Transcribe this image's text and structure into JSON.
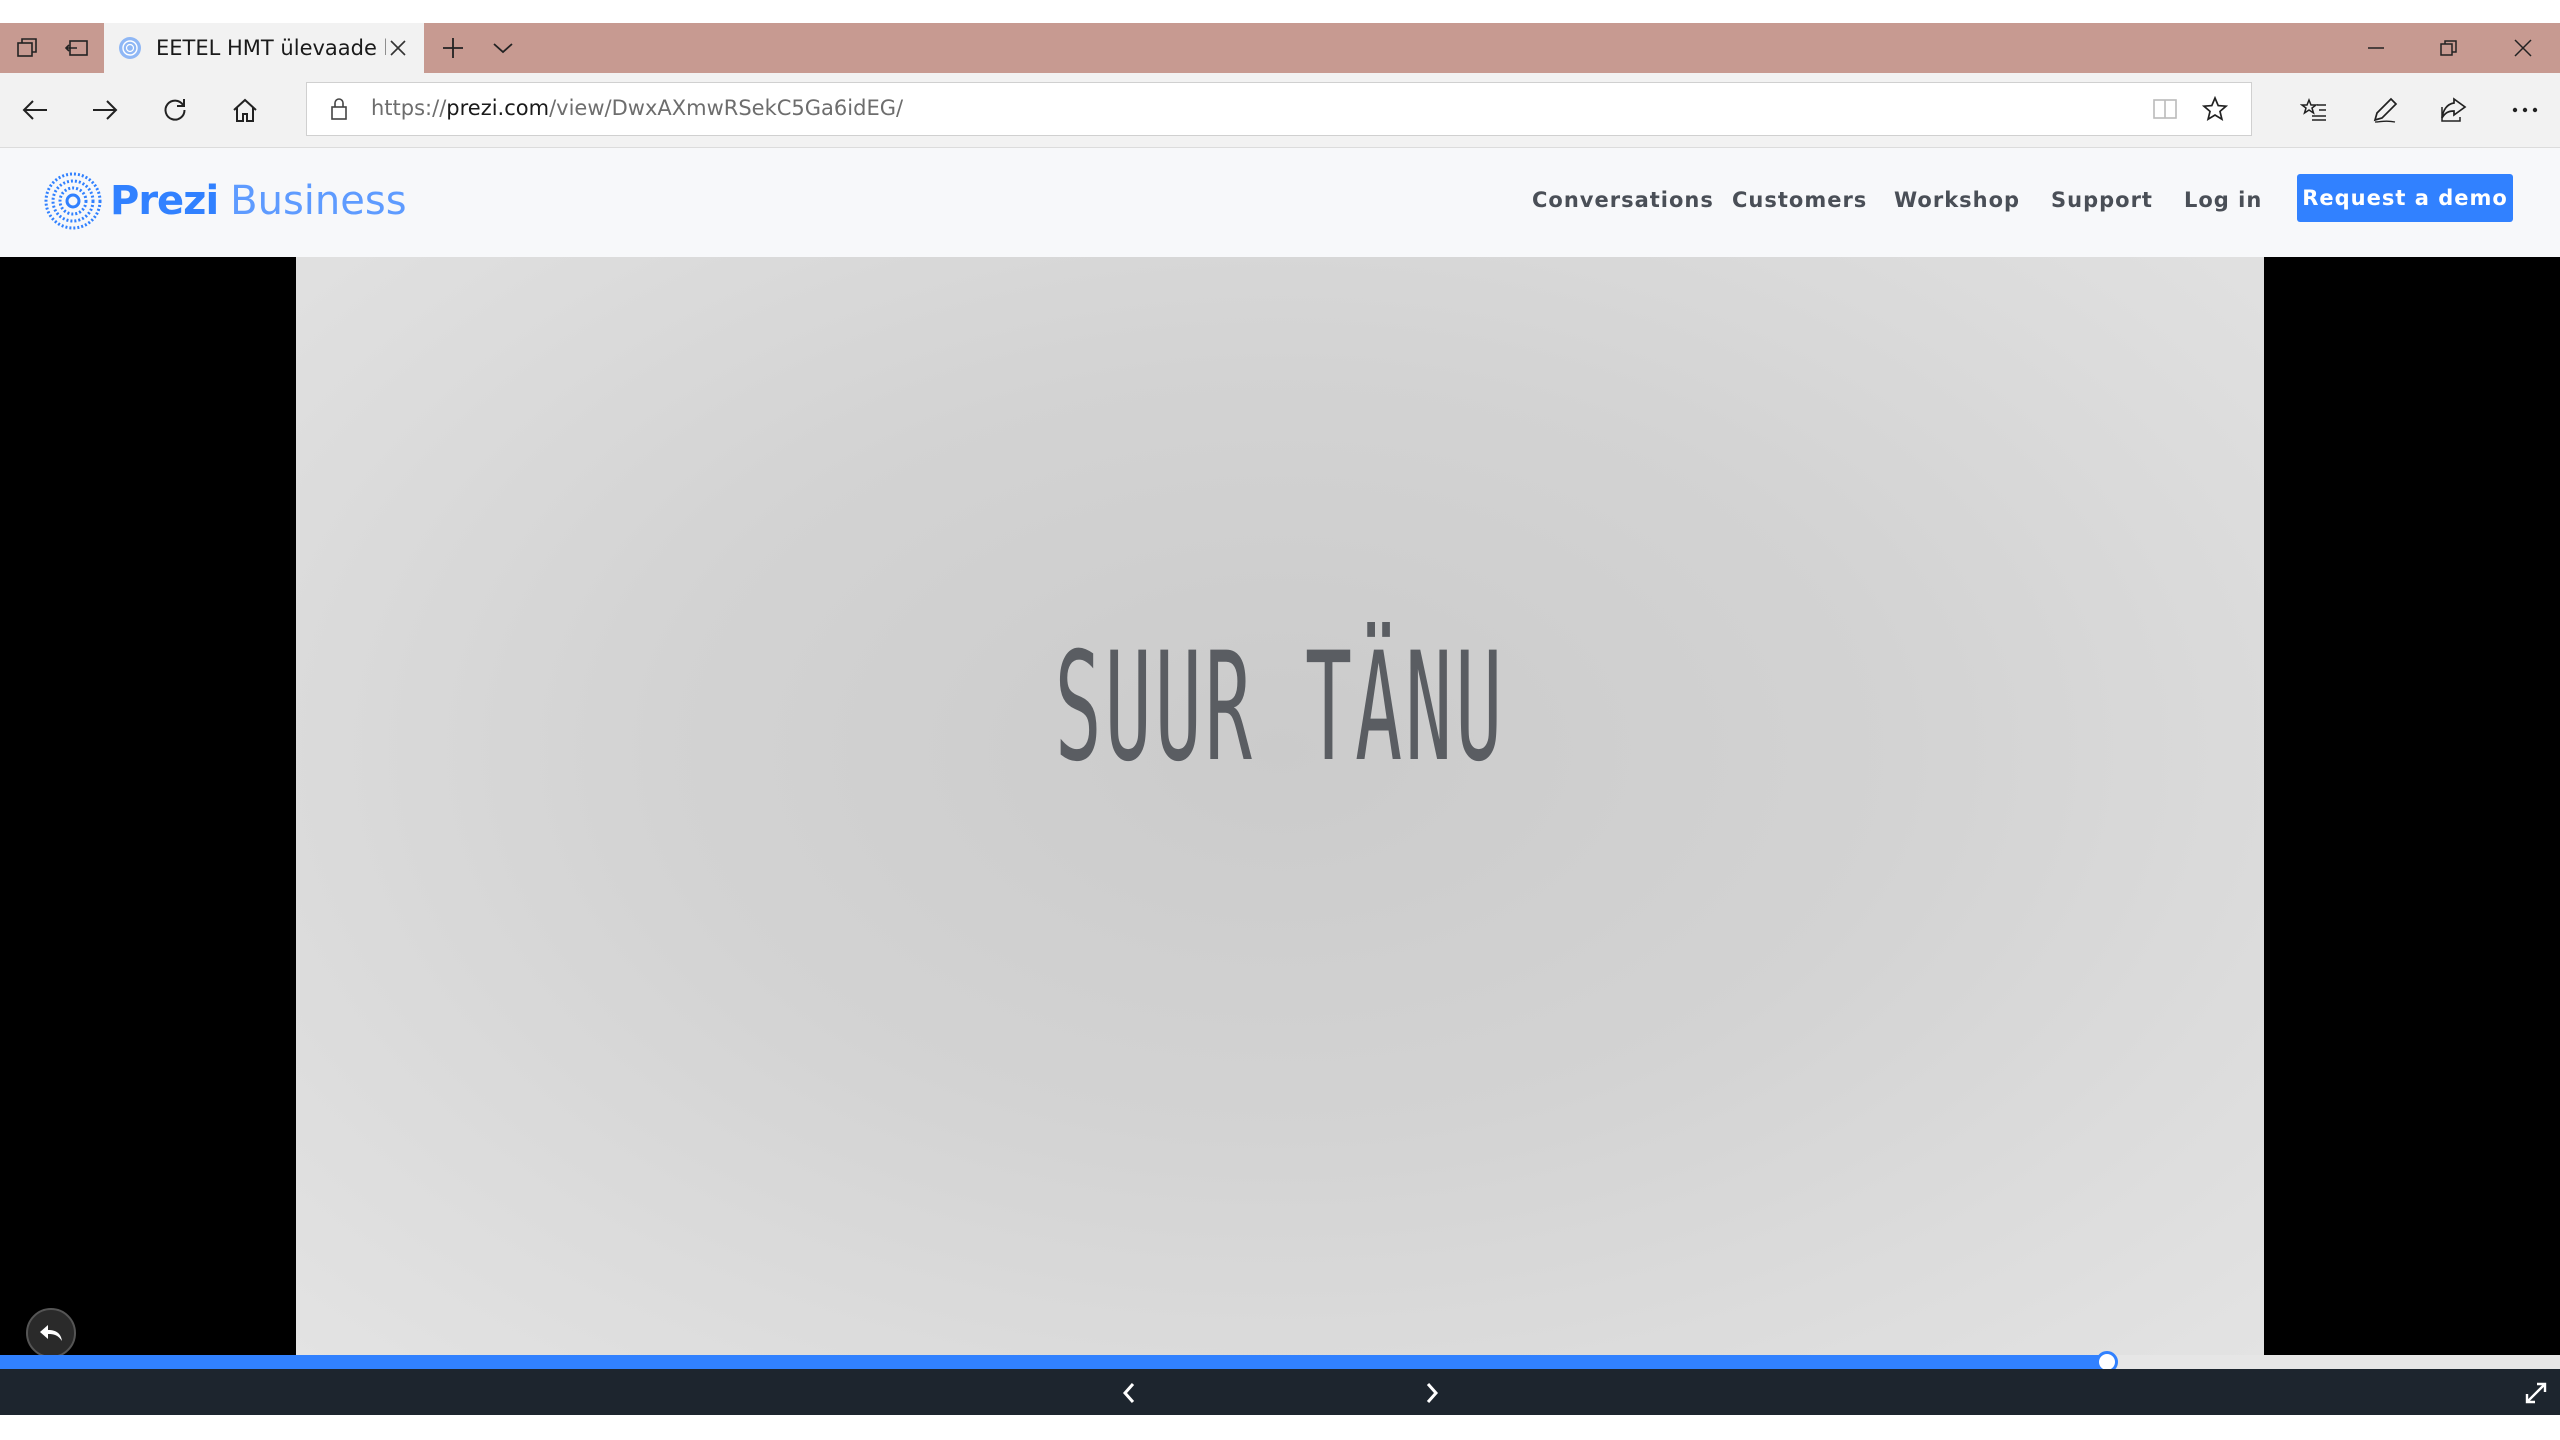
{
  "browser": {
    "tab_title": "EETEL HMT ülevaade by",
    "url_scheme": "https://",
    "url_host": "prezi.com",
    "url_path": "/view/DwxAXmwRSekC5Ga6idEG/"
  },
  "header": {
    "logo_prezi": "Prezi",
    "logo_business": "Business",
    "nav": {
      "conversations": "Conversations",
      "customers": "Customers",
      "workshop": "Workshop",
      "support": "Support",
      "login": "Log in"
    },
    "demo_button": "Request a demo"
  },
  "slide": {
    "text": "SUUR TÄNU"
  },
  "player": {
    "progress_fraction": 0.823
  },
  "colors": {
    "accent": "#3181ff",
    "tabstrip": "#c79a91",
    "controls_bar": "#1d252e"
  },
  "icons": [
    "tab-overview-icon",
    "tab-aside-icon",
    "favicon-icon",
    "close-tab-icon",
    "new-tab-icon",
    "tab-dropdown-icon",
    "minimize-icon",
    "restore-icon",
    "window-close-icon",
    "back-icon",
    "forward-icon",
    "refresh-icon",
    "home-icon",
    "lock-icon",
    "reading-view-icon",
    "favorite-star-icon",
    "favorites-hub-icon",
    "pen-icon",
    "share-icon",
    "more-icon",
    "prezi-logo-icon",
    "return-icon",
    "prev-slide-icon",
    "next-slide-icon",
    "fullscreen-icon"
  ]
}
